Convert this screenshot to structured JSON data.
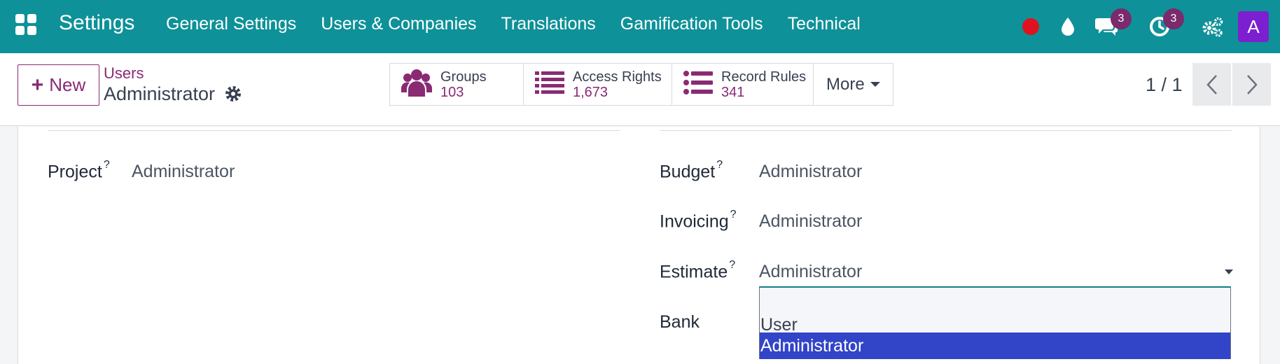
{
  "navbar": {
    "app_name": "Settings",
    "menu": [
      "General Settings",
      "Users & Companies",
      "Translations",
      "Gamification Tools",
      "Technical"
    ],
    "messages_badge": "3",
    "activities_badge": "3",
    "avatar_letter": "A"
  },
  "control": {
    "new_label": "New",
    "breadcrumb": "Users",
    "record_title": "Administrator",
    "stats": [
      {
        "label": "Groups",
        "value": "103"
      },
      {
        "label": "Access Rights",
        "value": "1,673"
      },
      {
        "label": "Record Rules",
        "value": "341"
      }
    ],
    "more_label": "More",
    "pager": "1 / 1"
  },
  "form": {
    "project": {
      "label": "Project",
      "value": "Administrator"
    },
    "budget": {
      "label": "Budget",
      "value": "Administrator"
    },
    "invoicing": {
      "label": "Invoicing",
      "value": "Administrator"
    },
    "estimate": {
      "label": "Estimate",
      "value": "Administrator"
    },
    "bank": {
      "label": "Bank"
    },
    "help_mark": "?",
    "dropdown_options": [
      "User",
      "Administrator"
    ]
  },
  "colors": {
    "navbar": "#0e9198",
    "brand_purple": "#8a2a73",
    "selected_option": "#3244c7",
    "record_dot": "#e0121f"
  }
}
